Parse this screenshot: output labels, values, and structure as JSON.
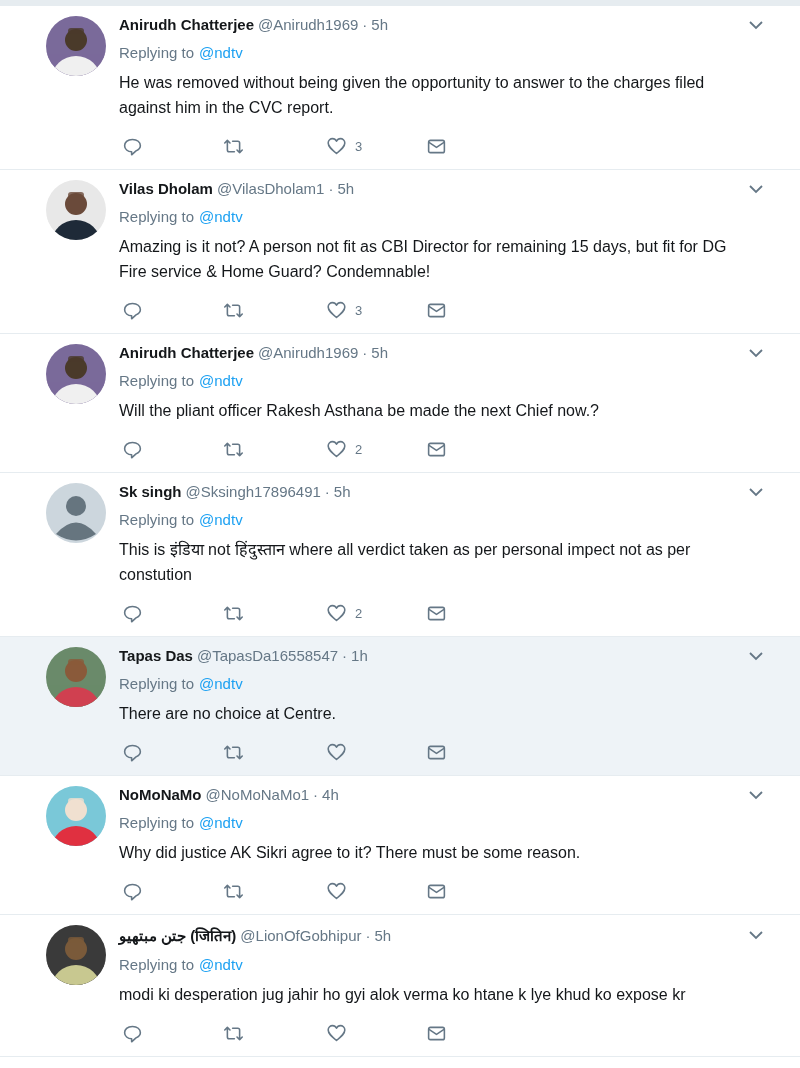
{
  "tweets": [
    {
      "name": "Anirudh Chatterjee",
      "handle": "@Anirudh1969",
      "separator": "·",
      "time": "5h",
      "replying_label": "Replying to",
      "replying_to": "@ndtv",
      "text": "He was removed without being given the opportunity  to answer  to the charges filed  against him in the CVC report.",
      "likes": "3",
      "highlighted": false
    },
    {
      "name": "Vilas Dholam",
      "handle": "@VilasDholam1",
      "separator": "·",
      "time": "5h",
      "replying_label": "Replying to",
      "replying_to": "@ndtv",
      "text": "Amazing is it not? A person not fit as CBI Director for remaining 15 days, but fit for DG Fire service & Home Guard? Condemnable!",
      "likes": "3",
      "highlighted": false
    },
    {
      "name": "Anirudh Chatterjee",
      "handle": "@Anirudh1969",
      "separator": "·",
      "time": "5h",
      "replying_label": "Replying to",
      "replying_to": "@ndtv",
      "text": "Will the pliant officer Rakesh Asthana be made the next Chief now.?",
      "likes": "2",
      "highlighted": false
    },
    {
      "name": "Sk singh",
      "handle": "@Sksingh17896491",
      "separator": "·",
      "time": "5h",
      "avatar": {
        "kind": "default"
      },
      "replying_label": "Replying to",
      "replying_to": "@ndtv",
      "text": "This is इंडिया not हिंदुस्तान where all verdict taken as per personal impect not as per constution",
      "likes": "2",
      "highlighted": false
    },
    {
      "name": "Tapas Das",
      "handle": "@TapasDa16558547",
      "separator": "·",
      "time": "1h",
      "replying_label": "Replying to",
      "replying_to": "@ndtv",
      "text": "There are no choice at Centre.",
      "highlighted": true
    },
    {
      "name": "NoMoNaMo",
      "handle": "@NoMoNaMo1",
      "separator": "·",
      "time": "4h",
      "replying_label": "Replying to",
      "replying_to": "@ndtv",
      "text": "Why did justice AK Sikri agree to it? There must be some reason.",
      "highlighted": false
    },
    {
      "name": "جتن مبتھیو (जितिन)",
      "handle": "@LionOfGobhipur",
      "separator": "·",
      "time": "5h",
      "replying_label": "Replying to",
      "replying_to": "@ndtv",
      "text": "modi ki desperation jug jahir ho gyi alok verma ko htane k lye khud ko expose kr",
      "highlighted": false
    }
  ]
}
